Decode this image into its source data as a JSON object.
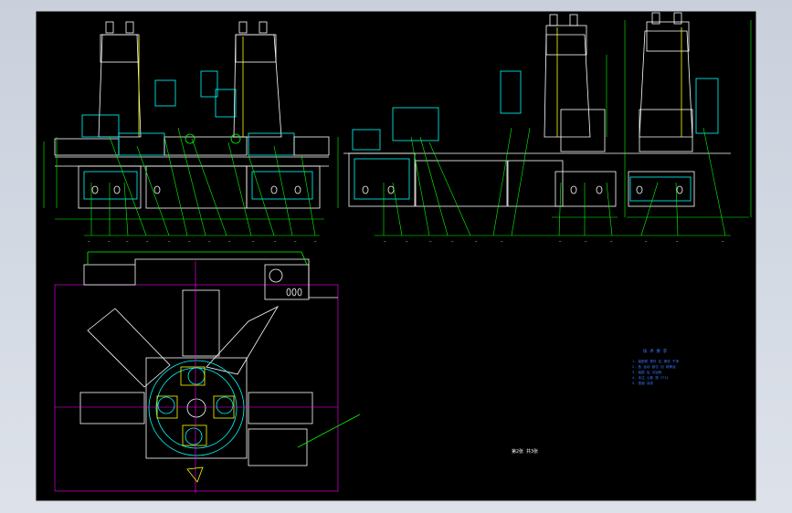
{
  "drawing": {
    "colors": {
      "background": "#000000",
      "frame": "#cfcfcf",
      "outline": "#ffffff",
      "dimension": "#00ff00",
      "component": "#00ffff",
      "centerline": "#ff00ff",
      "text": "#ffff00",
      "note": "#3a7cff"
    },
    "notes_title": "技 术 要 求",
    "notes": [
      "1. 装配前 零件 应 清洗 干净",
      "2. 各 运动 部位 加 润滑油",
      "3. 装配 后 试运转",
      "4. 未注 公差 按 IT12",
      "5. 表面 涂漆"
    ],
    "stamp": "第2张 共3张"
  }
}
